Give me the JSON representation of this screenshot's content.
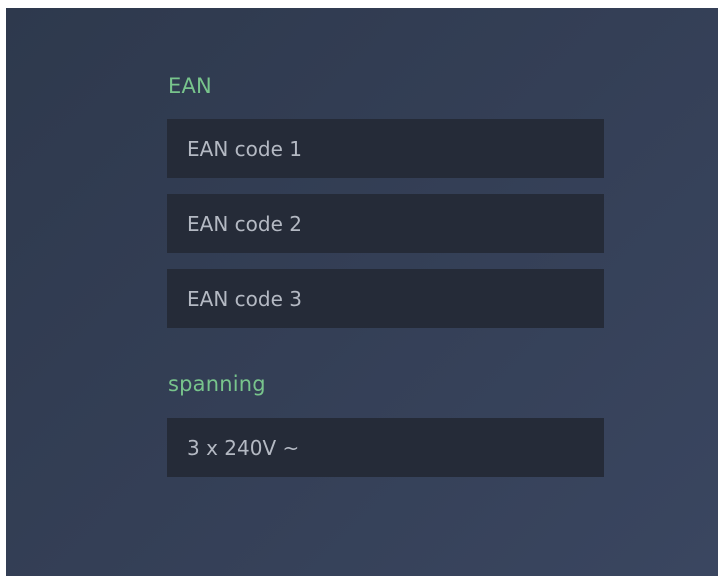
{
  "ean": {
    "label": "EAN",
    "fields": [
      {
        "placeholder": "EAN code 1"
      },
      {
        "placeholder": "EAN code 2"
      },
      {
        "placeholder": "EAN code 3"
      }
    ]
  },
  "spanning": {
    "label": "spanning",
    "value": "3 x 240V ~"
  },
  "colors": {
    "background": "#343f56",
    "label_accent": "#78c48c",
    "field_bg": "#252b38",
    "field_text": "#b4b9c3"
  }
}
